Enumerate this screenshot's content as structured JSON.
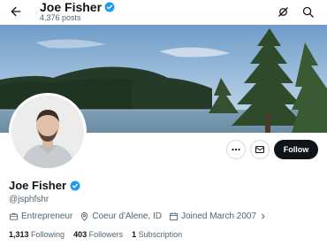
{
  "header": {
    "name": "Joe Fisher",
    "posts": "4,376 posts",
    "back_icon": "back-arrow-icon",
    "grok_icon": "grok-icon",
    "search_icon": "search-icon"
  },
  "profile": {
    "display_name": "Joe Fisher",
    "handle": "@jsphfshr",
    "verified": true,
    "verified_color": "#1d9bf0",
    "category": "Entrepreneur",
    "location": "Coeur d'Alene, ID",
    "joined": "Joined March 2007"
  },
  "actions": {
    "more_icon": "more-icon",
    "message_icon": "mail-icon",
    "follow_label": "Follow"
  },
  "stats": {
    "following_count": "1,313",
    "following_label": "Following",
    "followers_count": "403",
    "followers_label": "Followers",
    "subscription_count": "1",
    "subscription_label": "Subscription"
  },
  "colors": {
    "text_primary": "#0f1419",
    "text_secondary": "#536471",
    "follow_bg": "#0f1419",
    "accent": "#1d9bf0"
  }
}
